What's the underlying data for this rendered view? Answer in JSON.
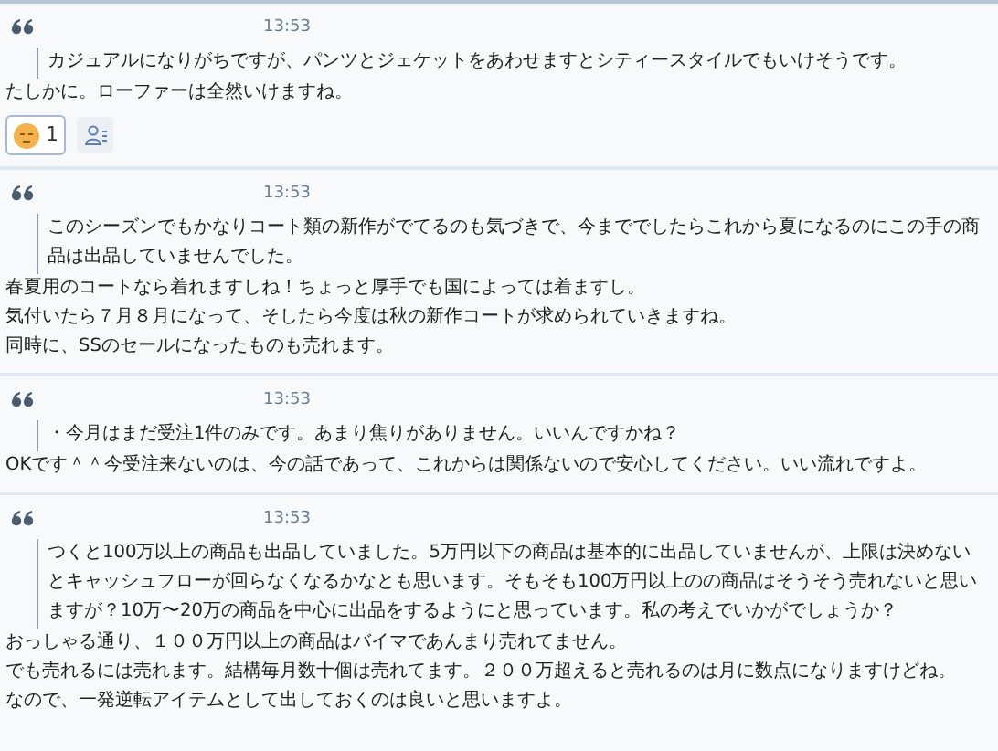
{
  "messages": [
    {
      "time": "13:53",
      "quote": "カジュアルになりがちですが、パンツとジェケットをあわせますとシティースタイルでもいけそうです。",
      "replies": [
        "たしかに。ローファーは全然いけますね。"
      ],
      "reactions": [
        {
          "count": "1",
          "selected": true
        }
      ]
    },
    {
      "time": "13:53",
      "quote": "このシーズンでもかなりコート類の新作がでてるのも気づきで、今まででしたらこれから夏になるのにこの手の商品は出品していませんでした。",
      "replies": [
        "春夏用のコートなら着れますしね！ちょっと厚手でも国によっては着ますし。",
        "気付いたら７月８月になって、そしたら今度は秋の新作コートが求められていきますね。",
        "同時に、SSのセールになったものも売れます。"
      ]
    },
    {
      "time": "13:53",
      "quote": "・今月はまだ受注1件のみです。あまり焦りがありません。いいんですかね？",
      "replies": [
        "OKです＾＾今受注来ないのは、今の話であって、これからは関係ないので安心してください。いい流れですよ。"
      ]
    },
    {
      "time": "13:53",
      "quote": "つくと100万以上の商品も出品していました。5万円以下の商品は基本的に出品していませんが、上限は決めないとキャッシュフローが回らなくなるかなとも思います。そもそも100万円以上のの商品はそうそう売れないと思いますが？10万〜20万の商品を中心に出品をするようにと思っています。私の考えでいかがでしょうか？",
      "replies": [
        "おっしゃる通り、１００万円以上の商品はバイマであんまり売れてません。",
        "でも売れるには売れます。結構毎月数十個は売れてます。２００万超えると売れるのは月に数点になりますけどね。",
        "なので、一発逆転アイテムとして出しておくのは良いと思いますよ。"
      ]
    }
  ]
}
